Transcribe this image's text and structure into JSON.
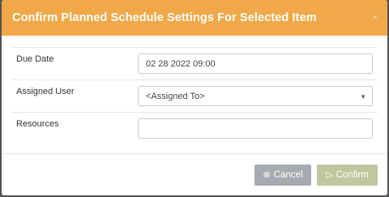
{
  "backdrop": {
    "text": "...."
  },
  "modal": {
    "title": "Confirm Planned Schedule Settings For Selected Item",
    "close_icon": "×"
  },
  "form": {
    "due_date": {
      "label": "Due Date",
      "value": "02 28 2022 09:00"
    },
    "assigned_user": {
      "label": "Assigned User",
      "selected": "<Assigned To>",
      "caret": "▼"
    },
    "resources": {
      "label": "Resources",
      "value": ""
    }
  },
  "footer": {
    "cancel_icon": "⊗",
    "cancel_label": "Cancel",
    "confirm_icon": "▷",
    "confirm_label": "Confirm"
  },
  "colors": {
    "header_bg": "#f0a848",
    "cancel_bg": "#a5abb0",
    "confirm_bg": "#bfc79e"
  }
}
